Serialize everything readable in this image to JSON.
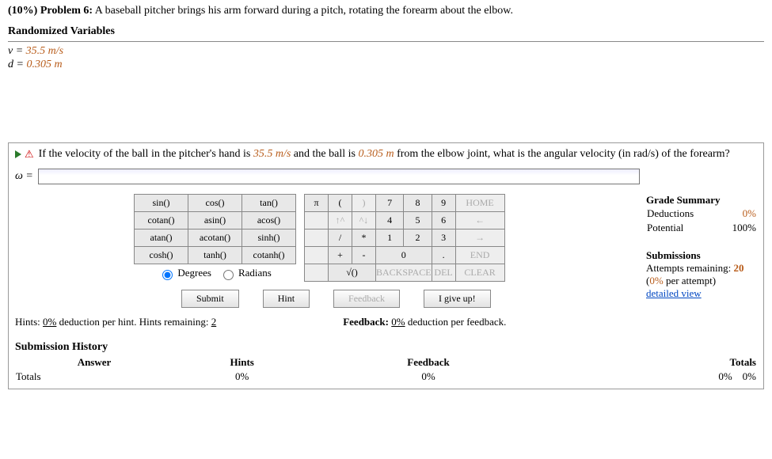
{
  "header": {
    "weight": "(10%) Problem 6:",
    "text": "A baseball pitcher brings his arm forward during a pitch, rotating the forearm about the elbow."
  },
  "vars_title": "Randomized Variables",
  "vars": {
    "v_label": "v = ",
    "v_value": "35.5 m/s",
    "d_label": "d = ",
    "d_value": "0.305 m"
  },
  "question": {
    "pre": "If the velocity of the ball in the pitcher's hand is ",
    "v": "35.5 m/s",
    "mid": " and the ball is ",
    "d": "0.305 m",
    "post": " from the elbow joint, what is the angular velocity (in rad/s) of the forearm?"
  },
  "answer": {
    "label": "ω =",
    "value": ""
  },
  "grade_summary": {
    "title": "Grade Summary",
    "deductions_label": "Deductions",
    "deductions_value": "0%",
    "potential_label": "Potential",
    "potential_value": "100%"
  },
  "submissions": {
    "title": "Submissions",
    "attempts_label": "Attempts remaining: ",
    "attempts_value": "20",
    "per_attempt": "(0% per attempt)",
    "detailed": "detailed view"
  },
  "funcs": {
    "r1": [
      "sin()",
      "cos()",
      "tan()"
    ],
    "r2": [
      "cotan()",
      "asin()",
      "acos()"
    ],
    "r3": [
      "atan()",
      "acotan()",
      "sinh()"
    ],
    "r4": [
      "cosh()",
      "tanh()",
      "cotanh()"
    ]
  },
  "modes": {
    "deg": "Degrees",
    "rad": "Radians"
  },
  "keypad": {
    "pi": "π",
    "lp": "(",
    "rp": ")",
    "n7": "7",
    "n8": "8",
    "n9": "9",
    "home": "HOME",
    "up": "↑^",
    "down": "^↓",
    "n4": "4",
    "n5": "5",
    "n6": "6",
    "left": "←",
    "slash": "/",
    "star": "*",
    "n1": "1",
    "n2": "2",
    "n3": "3",
    "right": "→",
    "plus": "+",
    "minus": "-",
    "n0": "0",
    "dot": ".",
    "end": "END",
    "sqrt": "√()",
    "back": "BACKSPACE",
    "del": "DEL",
    "clear": "CLEAR"
  },
  "buttons": {
    "submit": "Submit",
    "hint": "Hint",
    "feedback": "Feedback",
    "giveup": "I give up!"
  },
  "hints": {
    "pre": "Hints: ",
    "pct": "0%",
    "mid": " deduction per hint. Hints remaining: ",
    "rem": "2"
  },
  "feedback_line": {
    "pre": "Feedback: ",
    "pct": "0%",
    "post": " deduction per feedback."
  },
  "history": {
    "title": "Submission History",
    "cols": {
      "answer": "Answer",
      "hints": "Hints",
      "feedback": "Feedback",
      "totals": "Totals"
    },
    "row_label": "Totals",
    "zeros": "0%"
  }
}
